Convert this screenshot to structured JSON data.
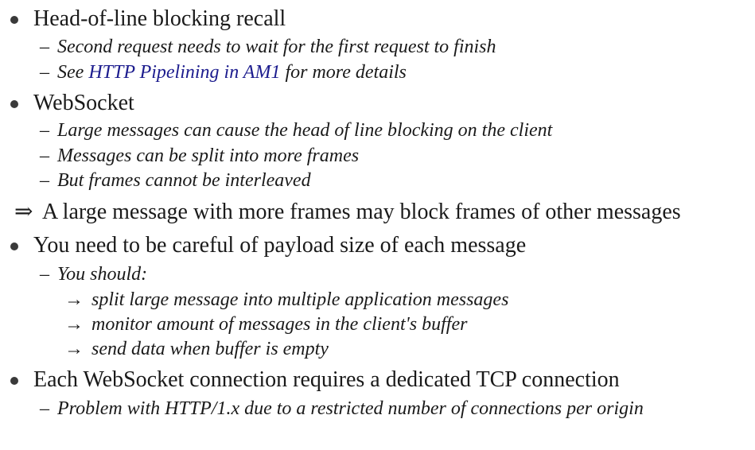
{
  "items": [
    {
      "text": "Head-of-line blocking recall",
      "subitems": [
        {
          "text": "Second request needs to wait for the first request to finish"
        },
        {
          "prefix": "See ",
          "link": "HTTP Pipelining in AM1",
          "suffix": " for more details"
        }
      ]
    },
    {
      "text": "WebSocket",
      "subitems": [
        {
          "text": "Large messages can cause the head of line blocking on the client"
        },
        {
          "text": "Messages can be split into more frames"
        },
        {
          "text": "But frames cannot be interleaved"
        }
      ]
    },
    {
      "implies_symbol": "⇒",
      "text": "A large message with more frames may block frames of other messages"
    },
    {
      "text": "You need to be careful of payload size of each message",
      "subitems": [
        {
          "text": "You should:",
          "subitems": [
            {
              "text": "split large message into multiple application messages"
            },
            {
              "text": "monitor amount of messages in the client's buffer"
            },
            {
              "text": "send data when buffer is empty"
            }
          ]
        }
      ]
    },
    {
      "text": "Each WebSocket connection requires a dedicated TCP connection",
      "subitems": [
        {
          "text": "Problem with HTTP/1.x due to a restricted number of connections per origin"
        }
      ]
    }
  ],
  "symbols": {
    "dash": "–",
    "arrow": "→"
  },
  "colors": {
    "text": "#1a1a1a",
    "link": "#1c1c8e",
    "bullet": "#3a3a3a"
  }
}
